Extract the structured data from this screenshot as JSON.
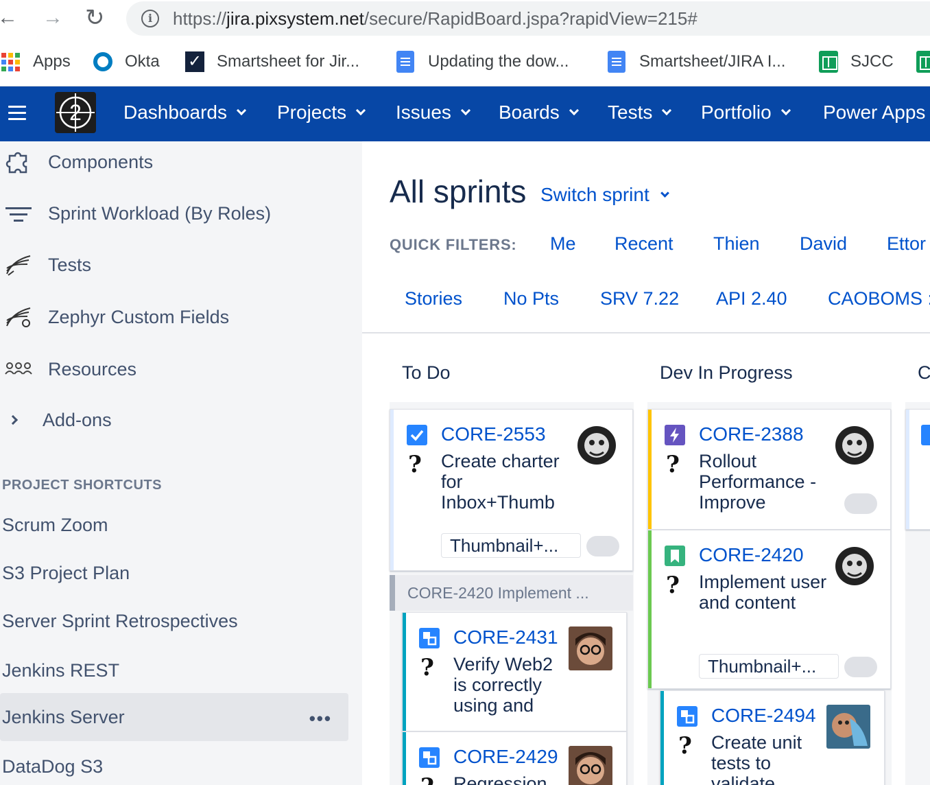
{
  "browser": {
    "back": "←",
    "forward": "→",
    "reload": "↻",
    "url_scheme": "https://",
    "url_host": "jira.pixsystem.net",
    "url_path": "/secure/RapidBoard.jspa?rapidView=215#",
    "info_icon": "i"
  },
  "bookmarks": [
    {
      "label": "Apps",
      "icon": "apps-grid-icon"
    },
    {
      "label": "Okta",
      "icon": "okta-icon"
    },
    {
      "label": "Smartsheet for Jir...",
      "icon": "smartsheet-icon"
    },
    {
      "label": "Updating the dow...",
      "icon": "google-docs-icon"
    },
    {
      "label": "Smartsheet/JIRA I...",
      "icon": "google-docs-icon"
    },
    {
      "label": "SJCC",
      "icon": "google-sheets-icon"
    }
  ],
  "topnav": {
    "logo_text": "2",
    "items": [
      "Dashboards",
      "Projects",
      "Issues",
      "Boards",
      "Tests",
      "Portfolio",
      "Power Apps"
    ]
  },
  "sidebar": {
    "items": [
      {
        "label": "Components",
        "icon": "puzzle-icon"
      },
      {
        "label": "Sprint Workload (By Roles)",
        "icon": "filter-icon"
      },
      {
        "label": "Tests",
        "icon": "zephyr-icon"
      },
      {
        "label": "Zephyr Custom Fields",
        "icon": "zephyr-fields-icon"
      },
      {
        "label": "Resources",
        "icon": "people-icon"
      },
      {
        "label": "Add-ons",
        "icon": "chevron-right-icon"
      }
    ],
    "section_title": "PROJECT SHORTCUTS",
    "shortcuts": [
      "Scrum Zoom",
      "S3 Project Plan",
      "Server Sprint Retrospectives",
      "Jenkins REST",
      "Jenkins Server",
      "DataDog S3"
    ],
    "active_shortcut": "Jenkins Server",
    "more": "•••"
  },
  "board": {
    "title": "All sprints",
    "switch_sprint": "Switch sprint",
    "quick_filters_label": "QUICK FILTERS:",
    "quick_filters_row1": [
      "Me",
      "Recent",
      "Thien",
      "David",
      "Ettor"
    ],
    "quick_filters_row2": [
      "Stories",
      "No Pts",
      "SRV 7.22",
      "API 2.40",
      "CAOBOMS :"
    ],
    "columns": [
      "To Do",
      "Dev In Progress",
      "C"
    ],
    "subtask_parent": "CORE-2420  Implement ...",
    "cards": {
      "c2553": {
        "key": "CORE-2553",
        "summary": "Create charter for Inbox+Thumb",
        "label": "Thumbnail+...",
        "type": "task",
        "q": "?",
        "accent": "#2684ff"
      },
      "c2388": {
        "key": "CORE-2388",
        "summary": "Rollout Performance - Improve",
        "type": "epic",
        "q": "?",
        "accent": "#ffc400"
      },
      "c2420": {
        "key": "CORE-2420",
        "summary": "Implement user and content",
        "label": "Thumbnail+...",
        "type": "story",
        "q": "?",
        "accent": "#6bc950"
      },
      "c2431": {
        "key": "CORE-2431",
        "summary": "Verify Web2 is correctly using and",
        "type": "subtask",
        "q": "?",
        "accent": "#00a3bf"
      },
      "c2429": {
        "key": "CORE-2429",
        "summary": "Regression",
        "type": "subtask",
        "q": "?",
        "accent": "#00a3bf"
      },
      "c2494": {
        "key": "CORE-2494",
        "summary": "Create unit tests to validate",
        "type": "subtask",
        "q": "?",
        "accent": "#00a3bf"
      }
    }
  }
}
